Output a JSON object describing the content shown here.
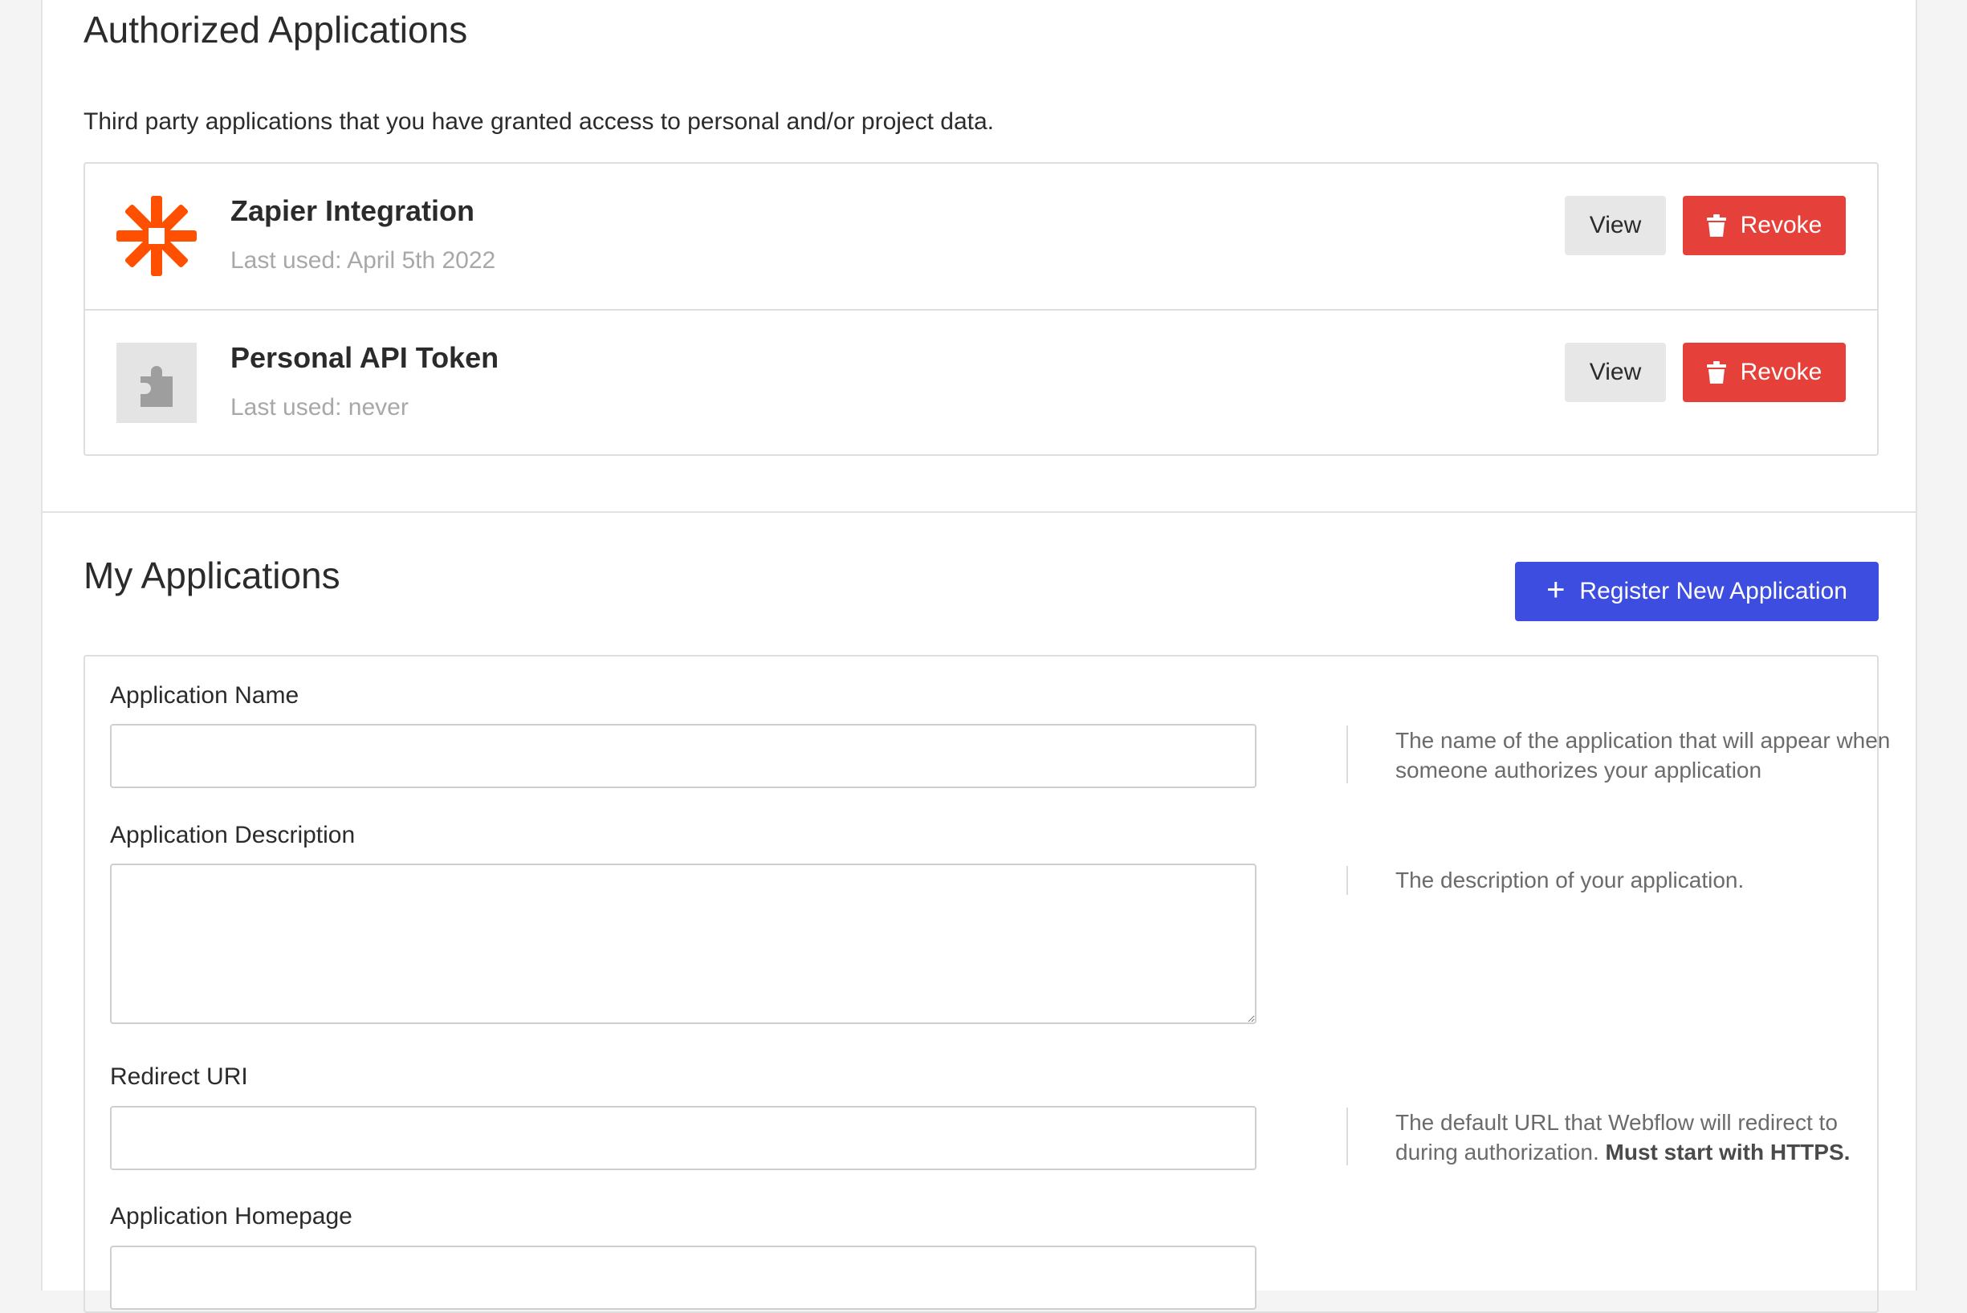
{
  "authorized": {
    "title": "Authorized Applications",
    "subtitle": "Third party applications that you have granted access to personal and/or project data.",
    "apps": [
      {
        "name": "Zapier Integration",
        "last_used": "Last used: April 5th 2022",
        "icon": "zapier-asterisk-icon",
        "view_label": "View",
        "revoke_label": "Revoke"
      },
      {
        "name": "Personal API Token",
        "last_used": "Last used: never",
        "icon": "puzzle-piece-icon",
        "view_label": "View",
        "revoke_label": "Revoke"
      }
    ]
  },
  "my_apps": {
    "title": "My Applications",
    "register_label": "Register New Application",
    "fields": [
      {
        "label": "Application Name",
        "value": "",
        "help": "The name of the application that will appear when someone authorizes your application"
      },
      {
        "label": "Application Description",
        "value": "",
        "help": "The description of your application."
      },
      {
        "label": "Redirect URI",
        "value": "",
        "help": "The default URL that Webflow will redirect to during authorization.",
        "help_strong": "Must start with HTTPS."
      },
      {
        "label": "Application Homepage",
        "value": ""
      }
    ]
  },
  "colors": {
    "revoke": "#e5403a",
    "primary": "#3c4de0",
    "zapier": "#ff4f00",
    "view_bg": "#e7e7e7"
  }
}
